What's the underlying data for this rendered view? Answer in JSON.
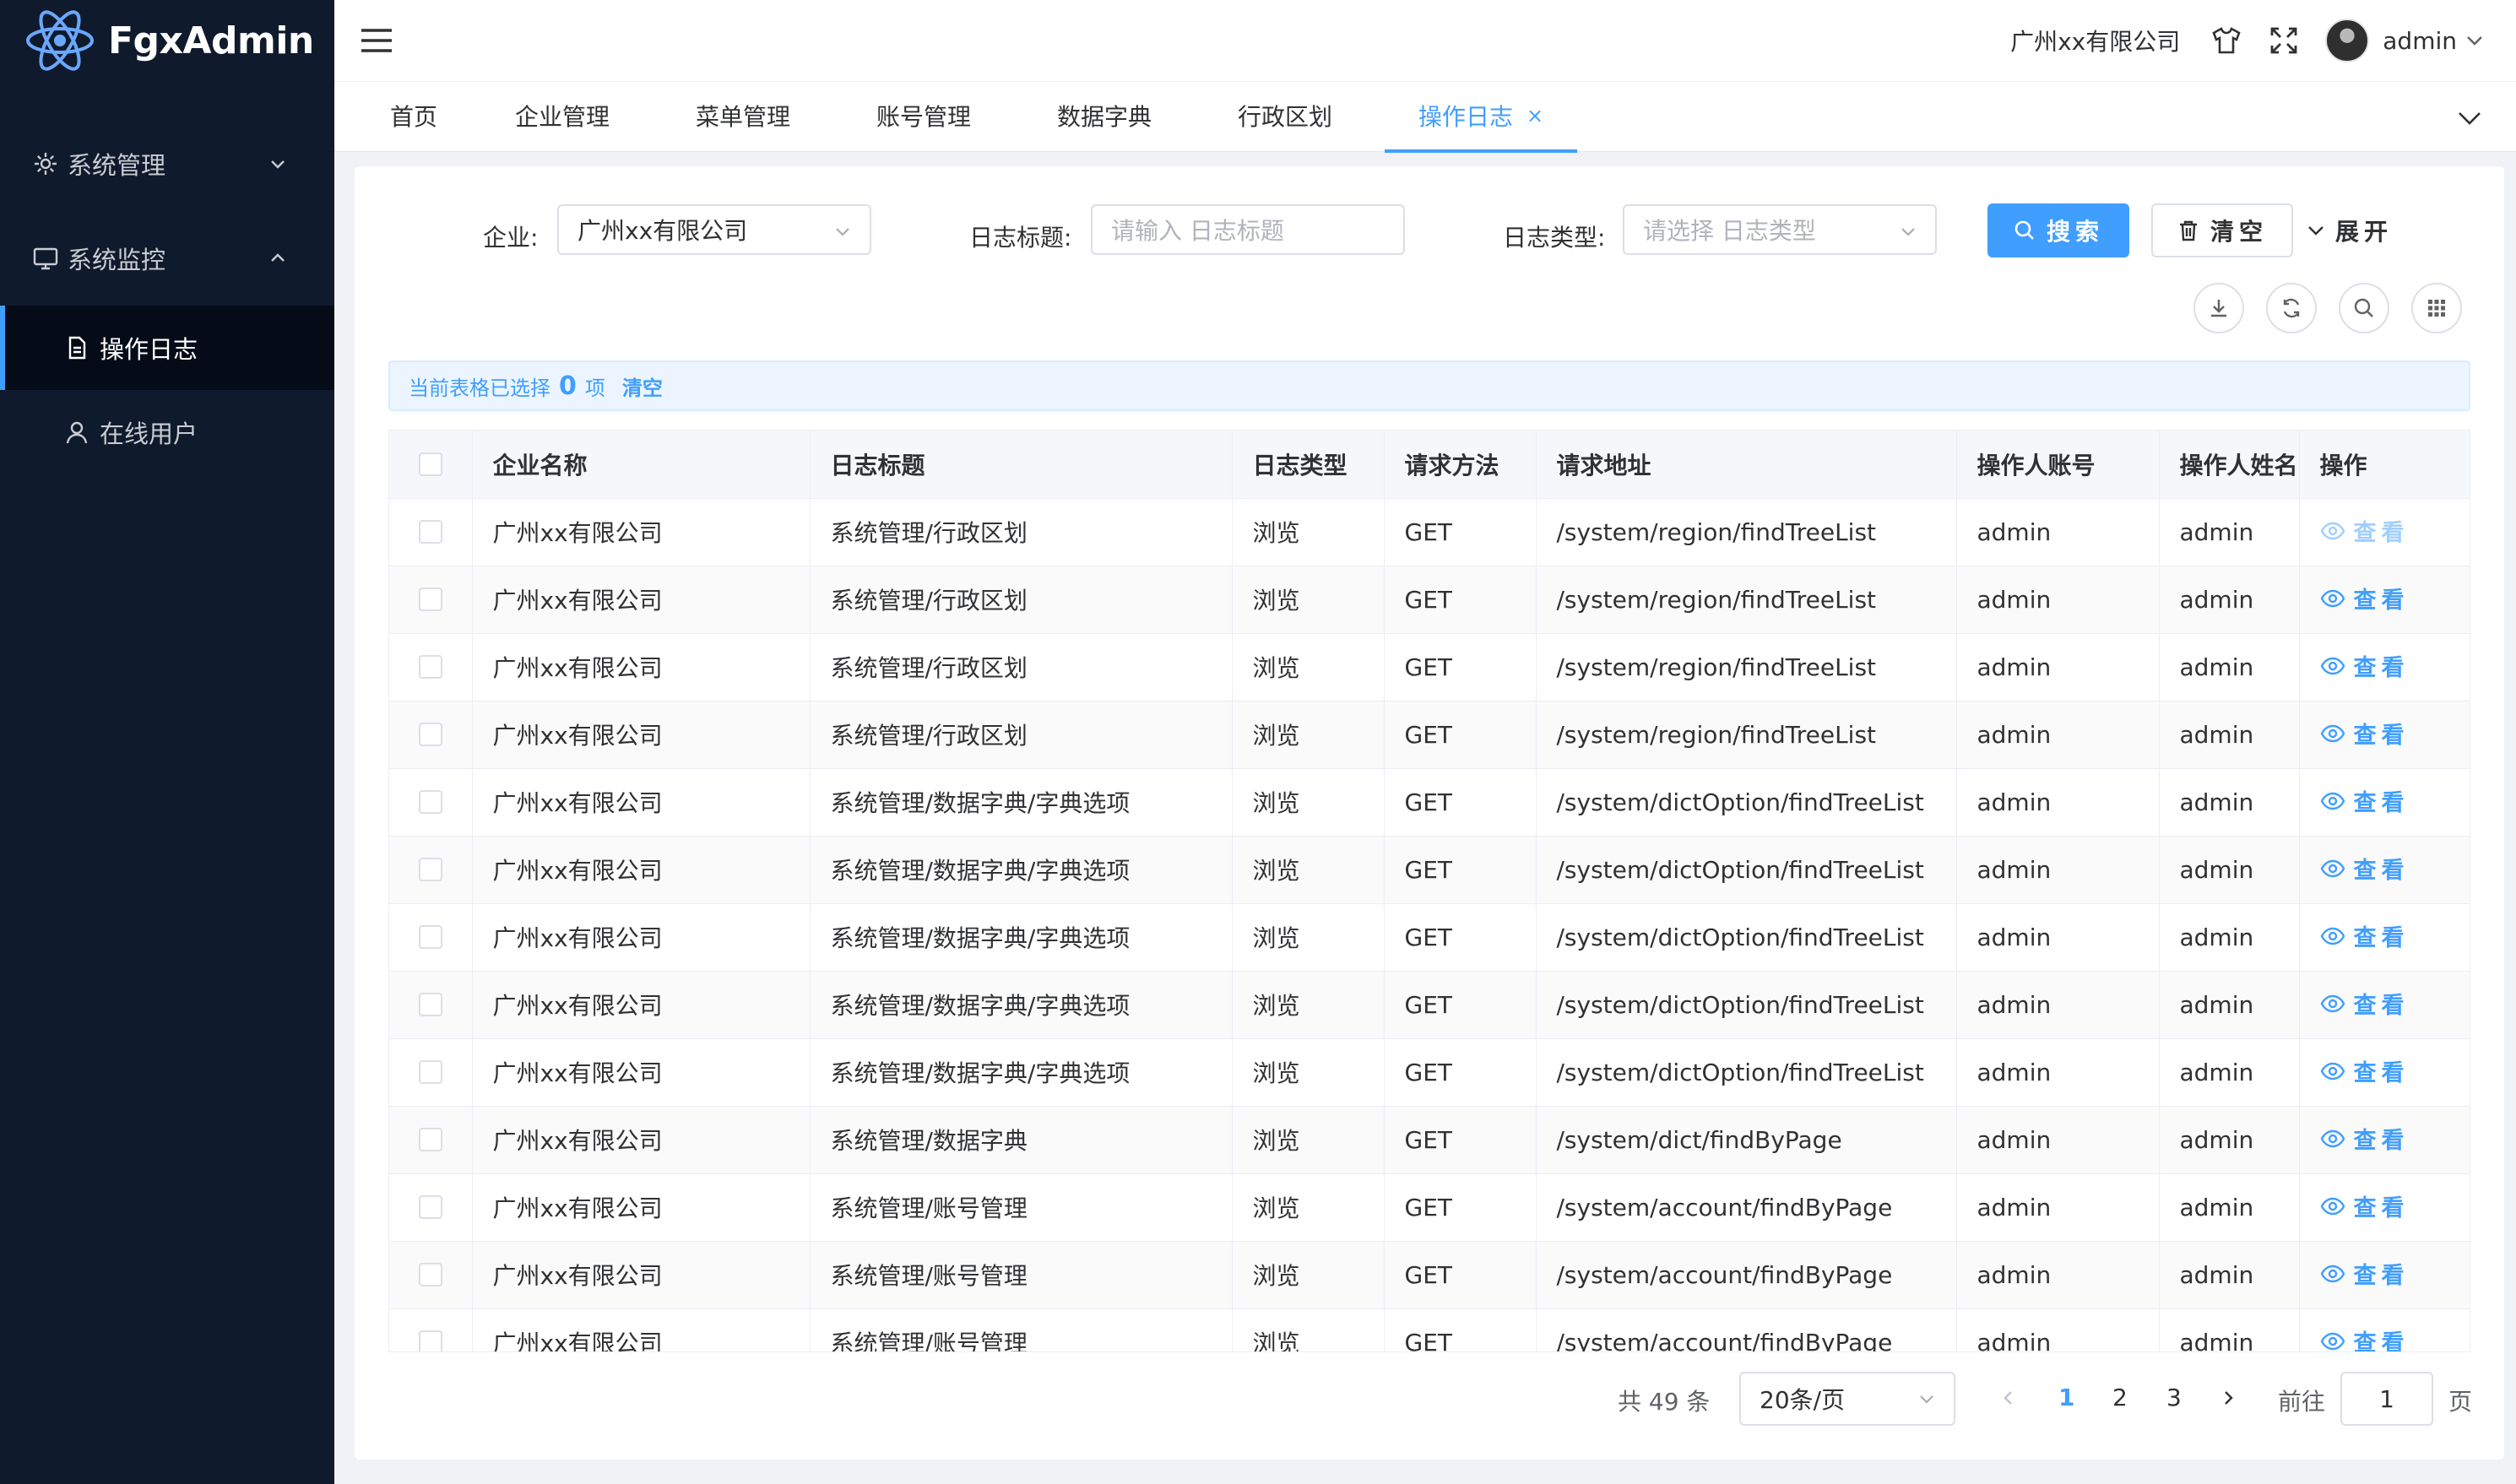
{
  "app": {
    "name": "FgxAdmin"
  },
  "sidebar": {
    "groups": [
      {
        "label": "系统管理",
        "icon": "gear-icon",
        "expanded": false
      },
      {
        "label": "系统监控",
        "icon": "monitor-icon",
        "expanded": true
      }
    ],
    "items": [
      {
        "label": "操作日志",
        "icon": "document-icon",
        "active": true
      },
      {
        "label": "在线用户",
        "icon": "user-icon",
        "active": false
      }
    ]
  },
  "header": {
    "company": "广州xx有限公司",
    "username": "admin",
    "icons": [
      "menu-toggle-icon",
      "shirt-icon",
      "fullscreen-icon",
      "avatar",
      "chevron-down-icon"
    ]
  },
  "tabs": [
    {
      "label": "首页"
    },
    {
      "label": "企业管理"
    },
    {
      "label": "菜单管理"
    },
    {
      "label": "账号管理"
    },
    {
      "label": "数据字典"
    },
    {
      "label": "行政区划"
    },
    {
      "label": "操作日志",
      "active": true,
      "closable": true,
      "close_glyph": "×"
    }
  ],
  "filters": {
    "company": {
      "label": "企业:",
      "value": "广州xx有限公司"
    },
    "title": {
      "label": "日志标题:",
      "placeholder": "请输入 日志标题"
    },
    "type": {
      "label": "日志类型:",
      "placeholder": "请选择 日志类型"
    },
    "search_label": "搜索",
    "clear_label": "清空",
    "expand_label": "展开"
  },
  "toolbar": {
    "icons": [
      "download-icon",
      "refresh-icon",
      "search-icon",
      "columns-icon"
    ]
  },
  "selection": {
    "prefix": "当前表格已选择",
    "count": "0",
    "suffix": "项",
    "clear": "清空"
  },
  "table": {
    "columns": [
      "企业名称",
      "日志标题",
      "日志类型",
      "请求方法",
      "请求地址",
      "操作人账号",
      "操作人姓名",
      "操作"
    ],
    "view_label": "查看",
    "rows": [
      {
        "company": "广州xx有限公司",
        "title": "系统管理/行政区划",
        "type": "浏览",
        "method": "GET",
        "url": "/system/region/findTreeList",
        "account": "admin",
        "name": "admin"
      },
      {
        "company": "广州xx有限公司",
        "title": "系统管理/行政区划",
        "type": "浏览",
        "method": "GET",
        "url": "/system/region/findTreeList",
        "account": "admin",
        "name": "admin"
      },
      {
        "company": "广州xx有限公司",
        "title": "系统管理/行政区划",
        "type": "浏览",
        "method": "GET",
        "url": "/system/region/findTreeList",
        "account": "admin",
        "name": "admin"
      },
      {
        "company": "广州xx有限公司",
        "title": "系统管理/行政区划",
        "type": "浏览",
        "method": "GET",
        "url": "/system/region/findTreeList",
        "account": "admin",
        "name": "admin"
      },
      {
        "company": "广州xx有限公司",
        "title": "系统管理/数据字典/字典选项",
        "type": "浏览",
        "method": "GET",
        "url": "/system/dictOption/findTreeList",
        "account": "admin",
        "name": "admin"
      },
      {
        "company": "广州xx有限公司",
        "title": "系统管理/数据字典/字典选项",
        "type": "浏览",
        "method": "GET",
        "url": "/system/dictOption/findTreeList",
        "account": "admin",
        "name": "admin"
      },
      {
        "company": "广州xx有限公司",
        "title": "系统管理/数据字典/字典选项",
        "type": "浏览",
        "method": "GET",
        "url": "/system/dictOption/findTreeList",
        "account": "admin",
        "name": "admin"
      },
      {
        "company": "广州xx有限公司",
        "title": "系统管理/数据字典/字典选项",
        "type": "浏览",
        "method": "GET",
        "url": "/system/dictOption/findTreeList",
        "account": "admin",
        "name": "admin"
      },
      {
        "company": "广州xx有限公司",
        "title": "系统管理/数据字典/字典选项",
        "type": "浏览",
        "method": "GET",
        "url": "/system/dictOption/findTreeList",
        "account": "admin",
        "name": "admin"
      },
      {
        "company": "广州xx有限公司",
        "title": "系统管理/数据字典",
        "type": "浏览",
        "method": "GET",
        "url": "/system/dict/findByPage",
        "account": "admin",
        "name": "admin"
      },
      {
        "company": "广州xx有限公司",
        "title": "系统管理/账号管理",
        "type": "浏览",
        "method": "GET",
        "url": "/system/account/findByPage",
        "account": "admin",
        "name": "admin"
      },
      {
        "company": "广州xx有限公司",
        "title": "系统管理/账号管理",
        "type": "浏览",
        "method": "GET",
        "url": "/system/account/findByPage",
        "account": "admin",
        "name": "admin"
      },
      {
        "company": "广州xx有限公司",
        "title": "系统管理/账号管理",
        "type": "浏览",
        "method": "GET",
        "url": "/system/account/findByPage",
        "account": "admin",
        "name": "admin"
      }
    ]
  },
  "pagination": {
    "total": "共 49 条",
    "page_size": "20条/页",
    "pages": [
      "1",
      "2",
      "3"
    ],
    "current": "1",
    "jump_label": "前往",
    "jump_value": "1",
    "page_suffix": "页"
  },
  "colors": {
    "accent": "#409eff",
    "sidebar_bg": "#0f1a2c",
    "sidebar_active_bg": "#050c18"
  }
}
